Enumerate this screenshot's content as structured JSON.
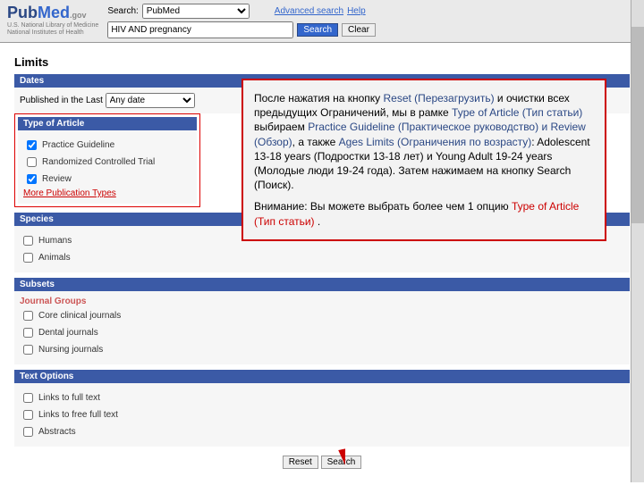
{
  "header": {
    "logo_pub": "Pub",
    "logo_med": "Med",
    "logo_gov": ".gov",
    "sub1": "U.S. National Library of Medicine",
    "sub2": "National Institutes of Health",
    "search_label": "Search:",
    "db": "PubMed",
    "query": "HIV AND pregnancy",
    "adv": "Advanced search",
    "help": "Help",
    "search_btn": "Search",
    "clear_btn": "Clear"
  },
  "limits": {
    "title": "Limits",
    "dates": "Dates",
    "pub_label": "Published in the Last",
    "pub_val": "Any date",
    "type": "Type of Article",
    "t1": "Practice Guideline",
    "t2": "Randomized Controlled Trial",
    "t3": "Review",
    "more": "More Publication Types",
    "species": "Species",
    "s1": "Humans",
    "s2": "Animals",
    "subsets": "Subsets",
    "jg": "Journal Groups",
    "j1": "Core clinical journals",
    "j2": "Dental journals",
    "j3": "Nursing journals",
    "text": "Text Options",
    "x1": "Links to full text",
    "x2": "Links to free full text",
    "x3": "Abstracts",
    "reset": "Reset",
    "search": "Search"
  },
  "callout": {
    "p1a": "После нажатия на кнопку ",
    "p1b": "Reset (Перезагрузить)",
    "p1c": " и очистки всех предыдущих Ограничений, мы в рамке ",
    "p1d": "Type of Article (Тип статьи)",
    "p1e": " выбираем ",
    "p1f": "Practice Guideline (Практическое руководство) и Review (Обзор)",
    "p1g": ", а также ",
    "p1h": "Ages Limits (Ограничения по возрасту)",
    "p1i": ": Adolescent 13-18 years (Подростки 13-18 лет) и Young Adult 19-24 years (Молодые люди 19-24 года). Затем нажимаем на кнопку Search (Поиск).",
    "p2a": "Внимание: Вы можете выбрать более чем 1 опцию ",
    "p2b": "Type of Article (Тип статьи)",
    "p2c": " ."
  }
}
